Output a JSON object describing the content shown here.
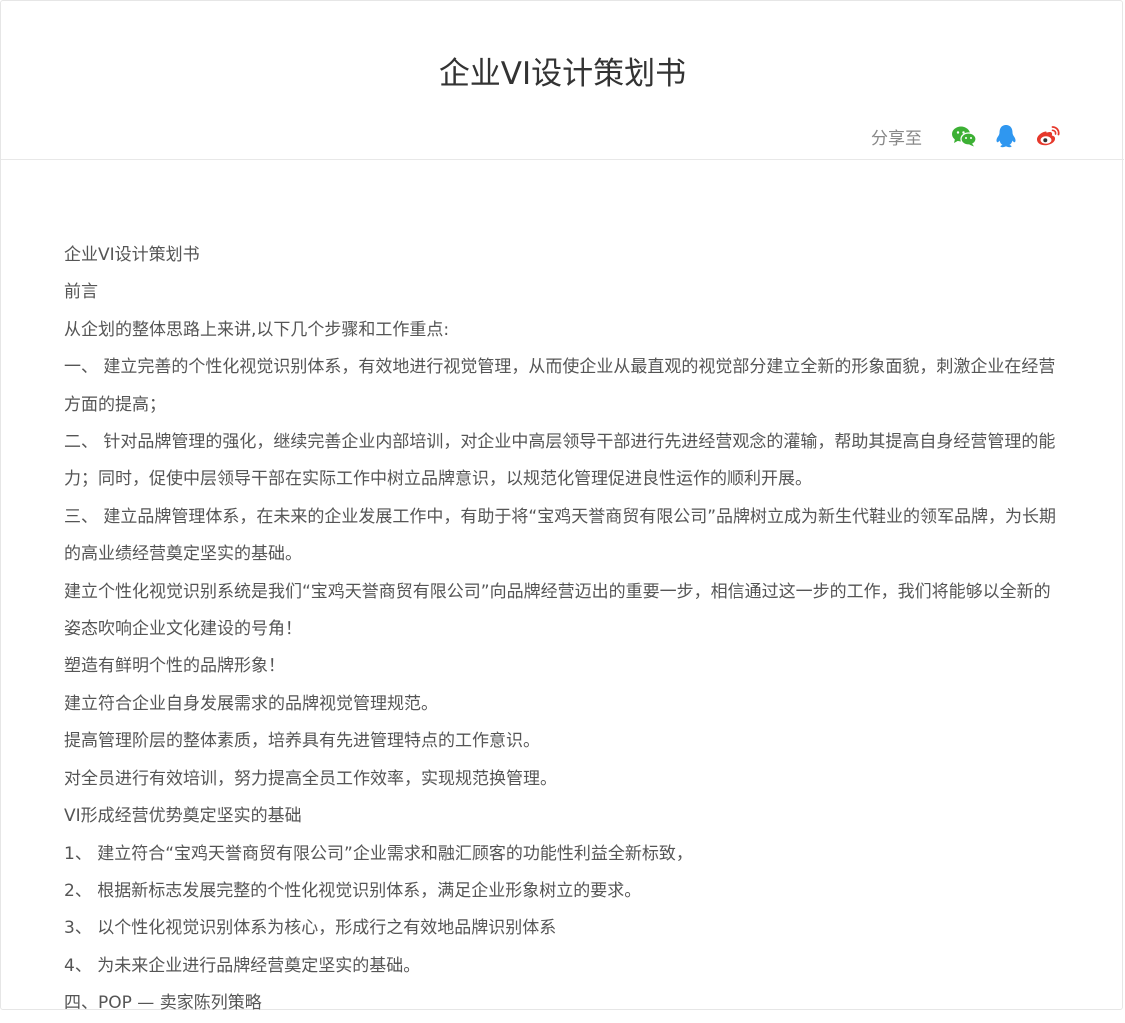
{
  "header": {
    "title": "企业VI设计策划书",
    "share_label": "分享至",
    "share_icons": [
      "wechat-icon",
      "qq-icon",
      "weibo-icon"
    ],
    "colors": {
      "wechat": "#3cb034",
      "qq": "#2f97f0",
      "weibo": "#e6382b"
    }
  },
  "article": {
    "paragraphs": [
      "企业VI设计策划书",
      "前言",
      "从企划的整体思路上来讲,以下几个步骤和工作重点:",
      "一、 建立完善的个性化视觉识别体系，有效地进行视觉管理，从而使企业从最直观的视觉部分建立全新的形象面貌，刺激企业在经营方面的提高；",
      "二、 针对品牌管理的强化，继续完善企业内部培训，对企业中高层领导干部进行先进经营观念的灌输，帮助其提高自身经营管理的能力；同时，促使中层领导干部在实际工作中树立品牌意识，以规范化管理促进良性运作的顺利开展。",
      "三、 建立品牌管理体系，在未来的企业发展工作中，有助于将“宝鸡天誉商贸有限公司”品牌树立成为新生代鞋业的领军品牌，为长期的高业绩经营奠定坚实的基础。",
      "建立个性化视觉识别系统是我们“宝鸡天誉商贸有限公司”向品牌经营迈出的重要一步，相信通过这一步的工作，我们将能够以全新的姿态吹响企业文化建设的号角！",
      "塑造有鲜明个性的品牌形象！",
      "建立符合企业自身发展需求的品牌视觉管理规范。",
      "提高管理阶层的整体素质，培养具有先进管理特点的工作意识。",
      "对全员进行有效培训，努力提高全员工作效率，实现规范换管理。",
      "VI形成经营优势奠定坚实的基础",
      "1、 建立符合“宝鸡天誉商贸有限公司”企业需求和融汇顾客的功能性利益全新标致，",
      "2、 根据新标志发展完整的个性化视觉识别体系，满足企业形象树立的要求。",
      "3、 以个性化视觉识别体系为核心，形成行之有效地品牌识别体系",
      "4、 为未来企业进行品牌经营奠定坚实的基础。",
      "四、POP — 卖家陈列策略"
    ]
  }
}
